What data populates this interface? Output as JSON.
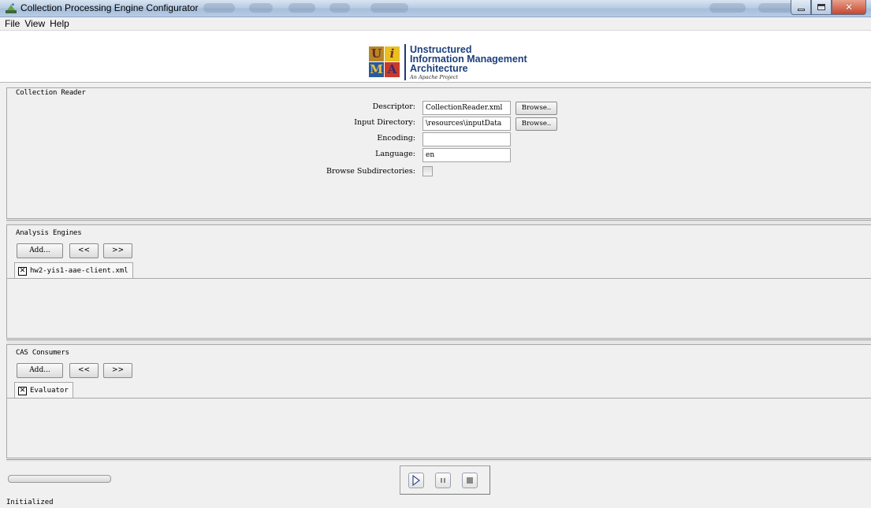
{
  "window": {
    "title": "Collection Processing Engine Configurator"
  },
  "menu": [
    "File",
    "View",
    "Help"
  ],
  "logo": {
    "line1": "Unstructured",
    "line2": "Information Management",
    "line3": "Architecture",
    "tagline": "An Apache Project",
    "letters": [
      "U",
      "i",
      "M",
      "A"
    ]
  },
  "collection_reader": {
    "title": "Collection Reader",
    "fields": [
      {
        "label": "Descriptor:",
        "value": "CollectionReader.xml",
        "has_browse": true
      },
      {
        "label": "Input Directory:",
        "value": "\\resources\\inputData",
        "has_browse": true
      },
      {
        "label": "Encoding:",
        "value": ""
      },
      {
        "label": "Language:",
        "value": "en"
      }
    ],
    "subdirs_label": "Browse Subdirectories:",
    "subdirs_checked": false,
    "browse_label": "Browse.."
  },
  "analysis_engines": {
    "title": "Analysis Engines",
    "add_label": "Add...",
    "move_left_label": "<<",
    "move_right_label": ">>",
    "tabs": [
      {
        "label": "hw2-yis1-aae-client.xml"
      }
    ]
  },
  "cas_consumers": {
    "title": "CAS Consumers",
    "add_label": "Add...",
    "move_left_label": "<<",
    "move_right_label": ">>",
    "tabs": [
      {
        "label": "Evaluator"
      }
    ]
  },
  "progress": 0,
  "status": "Initialized"
}
